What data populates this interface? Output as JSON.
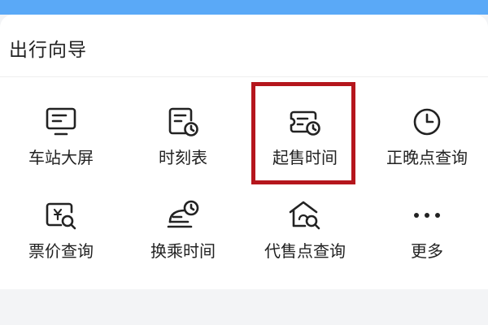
{
  "section": {
    "title": "出行向导"
  },
  "tiles": [
    {
      "label": "车站大屏",
      "icon": "monitor-icon"
    },
    {
      "label": "时刻表",
      "icon": "timetable-icon"
    },
    {
      "label": "起售时间",
      "icon": "ticket-clock-icon"
    },
    {
      "label": "正晚点查询",
      "icon": "clock-icon"
    },
    {
      "label": "票价查询",
      "icon": "price-search-icon"
    },
    {
      "label": "换乘时间",
      "icon": "train-clock-icon"
    },
    {
      "label": "代售点查询",
      "icon": "agency-search-icon"
    },
    {
      "label": "更多",
      "icon": "more-dots-icon"
    }
  ],
  "colors": {
    "header_blue": "#5aa9f7",
    "highlight_red": "#b5161d",
    "text": "#222222"
  }
}
